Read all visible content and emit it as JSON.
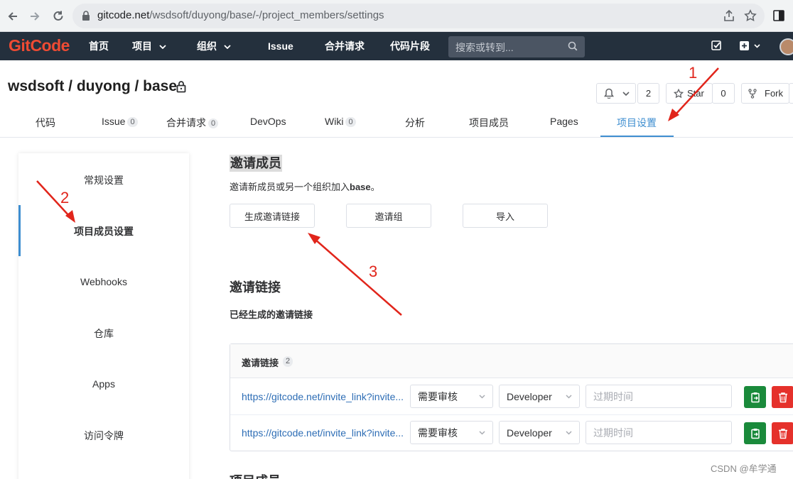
{
  "browser": {
    "url_host": "gitcode.net",
    "url_path": "/wsdsoft/duyong/base/-/project_members/settings"
  },
  "header": {
    "logo": "GitCode",
    "nav": [
      "首页",
      "项目",
      "组织",
      "Issue",
      "合并请求",
      "代码片段"
    ],
    "search_placeholder": "搜索或转到..."
  },
  "project": {
    "title": "wsdsoft / duyong / base",
    "notify_count": "2",
    "star_label": "Star",
    "star_count": "0",
    "fork_label": "Fork"
  },
  "tabs": [
    {
      "label": "代码",
      "count": ""
    },
    {
      "label": "Issue",
      "count": "0"
    },
    {
      "label": "合并请求",
      "count": "0"
    },
    {
      "label": "DevOps",
      "count": ""
    },
    {
      "label": "Wiki",
      "count": "0"
    },
    {
      "label": "分析",
      "count": ""
    },
    {
      "label": "项目成员",
      "count": ""
    },
    {
      "label": "Pages",
      "count": ""
    },
    {
      "label": "项目设置",
      "count": ""
    }
  ],
  "sidebar": {
    "items": [
      "常规设置",
      "项目成员设置",
      "Webhooks",
      "仓库",
      "Apps",
      "访问令牌"
    ]
  },
  "main": {
    "invite_heading": "邀请成员",
    "invite_desc": "邀请新成员或另一个组织加入",
    "invite_desc_target": "base",
    "invite_desc_end": "。",
    "btn_generate_link": "生成邀请链接",
    "btn_invite_group": "邀请组",
    "btn_import": "导入",
    "links_heading": "邀请链接",
    "links_subheading": "已经生成的邀请链接",
    "panel_title": "邀请链接",
    "panel_count": "2",
    "rows": [
      {
        "link": "https://gitcode.net/invite_link?invite...",
        "review": "需要审核",
        "role": "Developer",
        "expire_placeholder": "过期时间"
      },
      {
        "link": "https://gitcode.net/invite_link?invite...",
        "review": "需要审核",
        "role": "Developer",
        "expire_placeholder": "过期时间"
      }
    ],
    "members_heading": "项目成员"
  },
  "annotations": {
    "n1": "1",
    "n2": "2",
    "n3": "3",
    "color": "#e1251b"
  },
  "watermark": "CSDN @牟学通"
}
